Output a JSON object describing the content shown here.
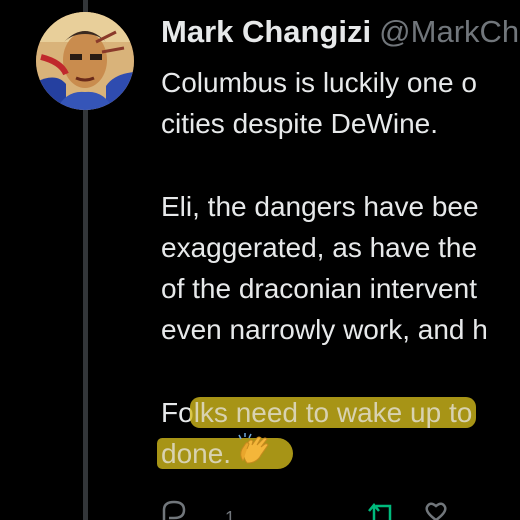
{
  "tweet": {
    "author": {
      "display_name": "Mark Changizi",
      "handle": "@MarkCh"
    },
    "paragraphs": [
      [
        "Columbus is luckily one o",
        "cities despite DeWine."
      ],
      [
        "Eli, the dangers have bee",
        "exaggerated, as have the",
        "of the draconian intervent",
        "even narrowly work, and h"
      ]
    ],
    "highlighted_paragraph": {
      "line1_plain": "Fo",
      "line1_highlight": "lks need to wake up to",
      "line2_highlight": "done.",
      "emoji_name": "clapping-hands-emoji"
    },
    "actions": {
      "reply_count": "1",
      "reply_icon": "reply-icon",
      "retweet_icon": "retweet-icon",
      "like_icon": "like-icon"
    }
  },
  "colors": {
    "background": "#000000",
    "text": "#e7e9ea",
    "muted": "#71767b",
    "highlight": "#d6be1c",
    "retweet": "#00ba7c"
  }
}
